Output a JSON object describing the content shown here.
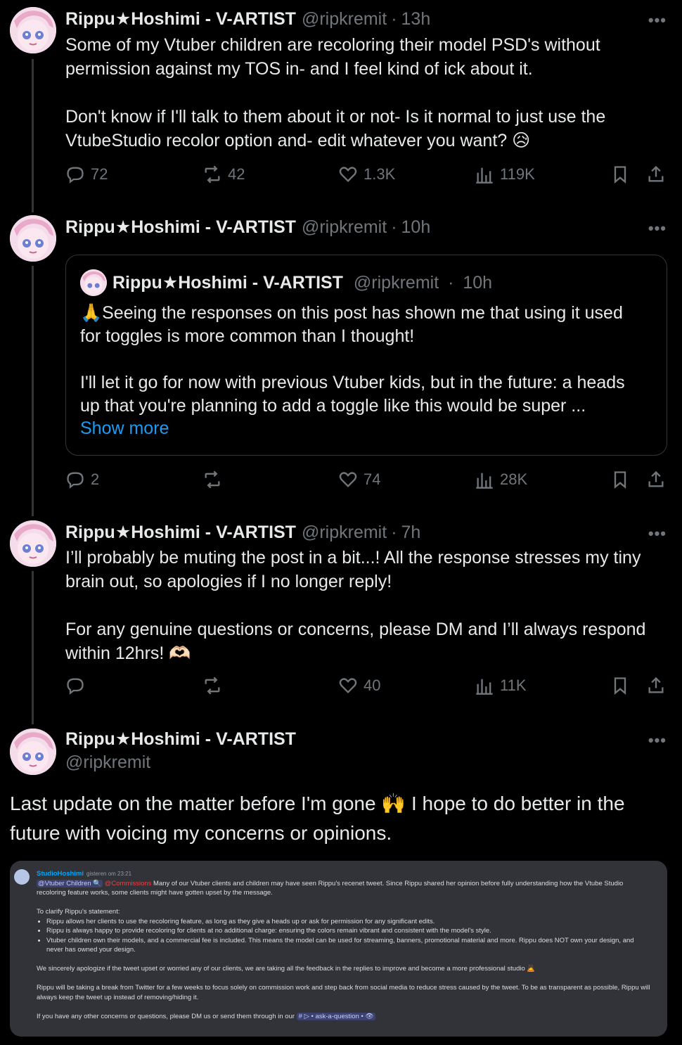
{
  "author": {
    "name": "Rippu★Hoshimi - V-ARTIST",
    "handle": "@ripkremit"
  },
  "more_label": "•••",
  "posts": [
    {
      "time": "13h",
      "text": "Some of my Vtuber children are recoloring their model PSD's without permission against my TOS in- and I feel kind of ick about it.\n\nDon't know if I'll talk to them about it or not- Is it normal to just use the VtubeStudio recolor option and- edit whatever you want? 😥",
      "replies": "72",
      "reposts": "42",
      "likes": "1.3K",
      "views": "119K"
    },
    {
      "time": "10h",
      "quote": {
        "time": "10h",
        "text": "🙏Seeing the responses on this post has shown me that using it used for toggles is more common than I thought!\n\nI'll let it go for now with previous Vtuber kids, but in the future: a heads up that you're planning to add a toggle like this would be super ...",
        "show_more": "Show more"
      },
      "replies": "2",
      "reposts": "",
      "likes": "74",
      "views": "28K"
    },
    {
      "time": "7h",
      "text": "I’ll probably be muting the post in a bit...! All the response stresses my tiny brain out, so apologies if I no longer reply!\n\nFor any genuine questions or concerns, please DM and I’ll always respond within 12hrs! 🫶🏻",
      "replies": "",
      "reposts": "",
      "likes": "40",
      "views": "11K"
    }
  ],
  "main_post": {
    "text": "Last update on the matter before I'm gone 🙌 I hope to do better in the future with voicing my concerns or opinions.",
    "embed": {
      "username": "StudioHoshimi",
      "timestamp": "gisteren om 23:21",
      "mention_1": "@Vtuber Children 🔍",
      "mention_2": "@Commissions",
      "intro": " Many of our Vtuber clients and children may have seen Rippu's recenet tweet. Since Rippu shared her opinion before fully understanding how the Vtube Studio recoloring feature works, some clients might have gotten upset by the message.",
      "clarify": "To clarify Rippu's statement:",
      "bullets": [
        "Rippu allows her clients to use the recoloring feature, as long as they give a heads up or ask for permission for any significant edits.",
        "Rippu is always happy to provide recoloring for clients at no additional charge: ensuring the colors remain vibrant and consistent with the model's style.",
        "Vtuber children own their models, and a commercial fee is included. This means the model can be used for streaming, banners, promotional material and more. Rippu does NOT own your design, and never has owned your design."
      ],
      "apology": "We sincerely apologize if the tweet upset or worried any of our clients, we are taking all the feedback in the replies to improve and become a more professional studio 🙇",
      "break": "Rippu will be taking a break from Twitter for a few weeks to focus solely on commission work and step back from social media to reduce stress caused by the tweet. To be as transparent as possible, Rippu will always keep the tweet up instead of removing/hiding it.",
      "contact": "If you have any other concerns or questions, please DM us or send them through in our ",
      "channel": "# ▷ • ask-a-question • 👁"
    }
  }
}
